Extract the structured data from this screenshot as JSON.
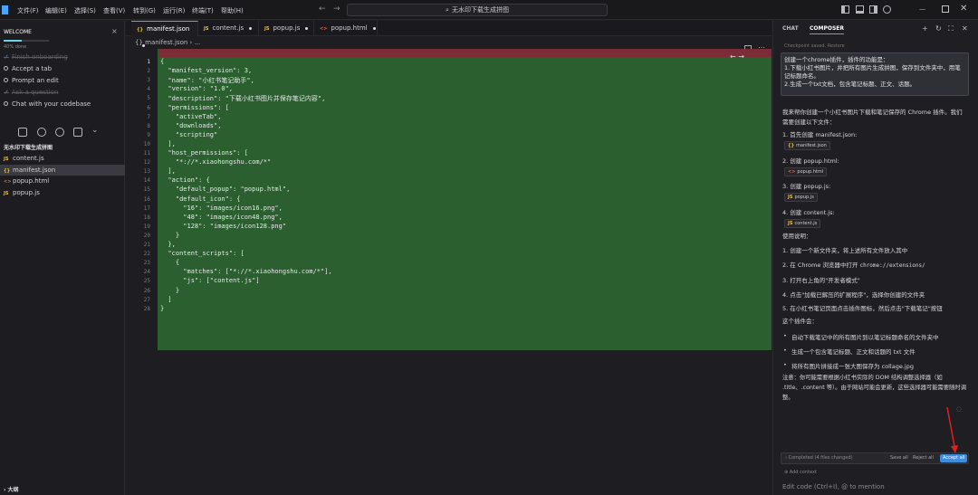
{
  "titlebar": {
    "menus": [
      "文件(F)",
      "编辑(E)",
      "选择(S)",
      "查看(V)",
      "转到(G)",
      "运行(R)",
      "终端(T)",
      "帮助(H)"
    ],
    "search_text": "无水印下载生成拼图",
    "nav_back": "←",
    "nav_forward": "→",
    "win_min": "—",
    "win_close": "✕"
  },
  "welcome": {
    "title": "WELCOME",
    "close": "×",
    "progress_text": "40% done",
    "progress_fraction": 0.4,
    "steps": [
      {
        "label": "Finish onboarding",
        "done": true
      },
      {
        "label": "Accept a tab",
        "done": false
      },
      {
        "label": "Prompt an edit",
        "done": false
      },
      {
        "label": "Ask a question",
        "done": true
      },
      {
        "label": "Chat with your codebase",
        "done": false
      }
    ]
  },
  "explorer": {
    "folder": "无水印下载生成拼图",
    "files": [
      {
        "name": "content.js",
        "type": "JS",
        "active": false
      },
      {
        "name": "manifest.json",
        "type": "{}",
        "active": true
      },
      {
        "name": "popup.html",
        "type": "<>",
        "active": false
      },
      {
        "name": "popup.js",
        "type": "JS",
        "active": false
      }
    ],
    "outline": "› 大纲"
  },
  "editor": {
    "tabs": [
      {
        "label": "manifest.json",
        "icon": "{}",
        "active": true
      },
      {
        "label": "content.js",
        "icon": "JS",
        "active": false
      },
      {
        "label": "popup.js",
        "icon": "JS",
        "active": false
      },
      {
        "label": "popup.html",
        "icon": "<>",
        "active": false
      }
    ],
    "breadcrumb": "{} manifest.json › ...",
    "diff_nav": "←  →",
    "lines": [
      "{",
      "  \"manifest_version\": 3,",
      "  \"name\": \"小红书笔记助手\",",
      "  \"version\": \"1.0\",",
      "  \"description\": \"下载小红书图片并保存笔记内容\",",
      "  \"permissions\": [",
      "    \"activeTab\",",
      "    \"downloads\",",
      "    \"scripting\"",
      "  ],",
      "  \"host_permissions\": [",
      "    \"*://*.xiaohongshu.com/*\"",
      "  ],",
      "  \"action\": {",
      "    \"default_popup\": \"popup.html\",",
      "    \"default_icon\": {",
      "      \"16\": \"images/icon16.png\",",
      "      \"48\": \"images/icon48.png\",",
      "      \"128\": \"images/icon128.png\"",
      "    }",
      "  },",
      "  \"content_scripts\": [",
      "    {",
      "      \"matches\": [\"*://*.xiaohongshu.com/*\"],",
      "      \"js\": [\"content.js\"]",
      "    }",
      "  ]",
      "}"
    ]
  },
  "composer": {
    "tabs": [
      "CHAT",
      "COMPOSER"
    ],
    "checkpoint": "Checkpoint saved. Restore",
    "user_message": "创建一个chrome插件，插件的功能是：\n1.下载小红书图片，并把所有图片生成拼图，保存到文件夹中，用笔记标题命名。\n2.生成一个txt文档，包含笔记标题、正文、话题。",
    "intro": "我来帮你创建一个小红书图片下载和笔记保存的 Chrome 插件。我们需要创建以下文件：",
    "file_steps": [
      {
        "label": "1. 首先创建 manifest.json:",
        "chip": "manifest.json",
        "icon": "{}"
      },
      {
        "label": "2. 创建 popup.html:",
        "chip": "popup.html",
        "icon": "<>"
      },
      {
        "label": "3. 创建 popup.js:",
        "chip": "popup.js",
        "icon": "JS"
      },
      {
        "label": "4. 创建 content.js:",
        "chip": "content.js",
        "icon": "JS"
      }
    ],
    "usage_title": "使用说明：",
    "usage": [
      "1. 创建一个新文件夹，将上述所有文件放入其中",
      "2. 在 Chrome 浏览器中打开 ",
      "3. 打开右上角的\"开发者模式\"",
      "4. 点击\"加载已解压的扩展程序\"，选择你创建的文件夹",
      "5. 在小红书笔记页面点击插件图标，然后点击\"下载笔记\"按钮"
    ],
    "chrome_url": "chrome://extensions/",
    "plugin_will": "这个插件会：",
    "bullets": [
      "自动下载笔记中的所有图片到以笔记标题命名的文件夹中",
      "生成一个包含笔记标题、正文和话题的 txt 文件",
      "将所有图片拼接成一张大图保存为 collage.jpg"
    ],
    "note": "注意：你可能需要根据小红书实际的 DOM 结构调整选择器（如 .title、.content 等）。由于网站可能会更新，这些选择器可能需要随时调整。",
    "completed": "›  Completed  (4 files changed)",
    "save_all": "Save all",
    "reject_all": "Reject all",
    "accept_all": "Accept all",
    "add_context": "⊕ Add context",
    "input_placeholder": "Edit code (Ctrl+I), @ to mention"
  }
}
